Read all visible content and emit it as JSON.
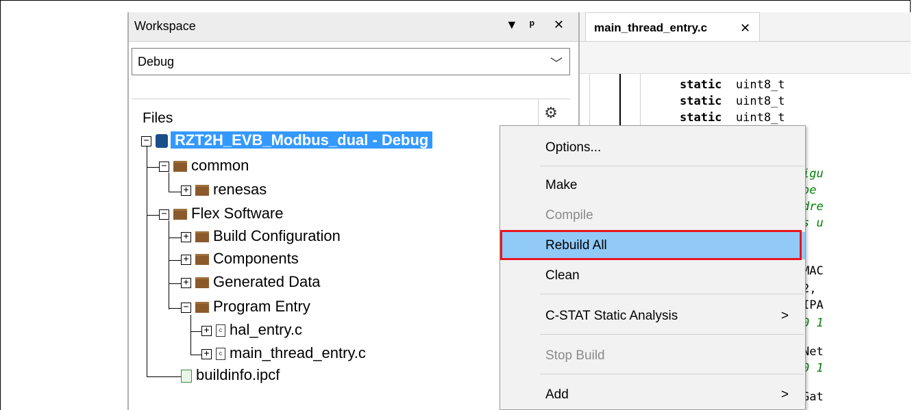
{
  "workspace": {
    "title": "Workspace",
    "btn_dropdown": "▼",
    "btn_pin": "ᵖ",
    "btn_close": "✕",
    "config_value": "Debug",
    "files_header": "Files",
    "tree": {
      "project": "RZT2H_EVB_Modbus_dual - Debug",
      "common": "common",
      "renesas": "renesas",
      "flex": "Flex Software",
      "build_config": "Build Configuration",
      "components": "Components",
      "generated": "Generated Data",
      "program_entry": "Program Entry",
      "hal_entry": "hal_entry.c",
      "main_thread": "main_thread_entry.c",
      "buildinfo": "buildinfo.ipcf"
    }
  },
  "editor": {
    "tab_name": "main_thread_entry.c",
    "tab_close": "✕",
    "lines": [
      {
        "kw": "static",
        "rest": "  uint8_t"
      },
      {
        "kw": "static",
        "rest": "  uint8_t"
      },
      {
        "kw": "static",
        "rest": "  uint8_t"
      }
    ],
    "right_fragments": [
      "igu",
      "be",
      "dre",
      "s u",
      "MAC",
      "2,",
      "IPA",
      "0 1",
      "Net",
      "0 1",
      "Gat"
    ]
  },
  "context_menu": {
    "items": [
      {
        "label": "Options...",
        "disabled": false
      },
      {
        "label": "Make",
        "disabled": false
      },
      {
        "label": "Compile",
        "disabled": true
      },
      {
        "label": "Rebuild All",
        "disabled": false,
        "highlighted": true
      },
      {
        "label": "Clean",
        "disabled": false
      },
      {
        "label": "C-STAT Static Analysis",
        "disabled": false,
        "submenu": true
      },
      {
        "label": "Stop Build",
        "disabled": true
      },
      {
        "label": "Add",
        "disabled": false,
        "submenu": true
      }
    ],
    "submenu_arrow": ">"
  },
  "colors": {
    "selection": "#3399ff",
    "menu_highlight": "#91c9f7",
    "callout": "#e8141f"
  }
}
